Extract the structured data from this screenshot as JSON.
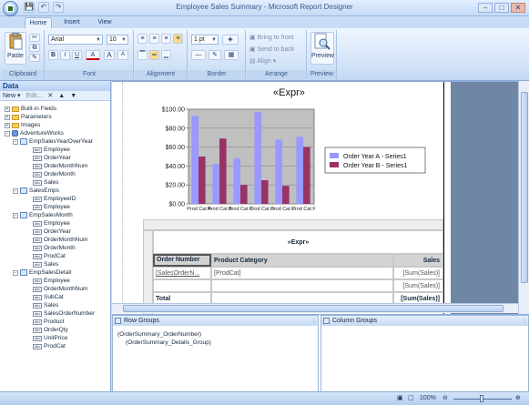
{
  "window": {
    "title": "Employee Sales Summary - Microsoft Report Designer"
  },
  "quick_access": {
    "save": "💾",
    "undo": "↶",
    "redo": "↷"
  },
  "tabs": [
    {
      "label": "Home"
    },
    {
      "label": "Insert"
    },
    {
      "label": "View"
    }
  ],
  "ribbon": {
    "clipboard": {
      "label": "Clipboard",
      "paste": "Paste"
    },
    "font": {
      "label": "Font",
      "family": "Arial",
      "size": "10",
      "bold": "B",
      "italic": "I",
      "underline": "U",
      "color": "A",
      "grow": "A",
      "shrink": "A"
    },
    "alignment": {
      "label": "Alignment"
    },
    "border": {
      "label": "Border",
      "width": "1 pt"
    },
    "arrange": {
      "label": "Arrange",
      "bring_to_front": "Bring to front",
      "send_to_back": "Send to back",
      "align": "Align"
    },
    "preview": {
      "label": "Preview",
      "button": "Preview"
    }
  },
  "data_pane": {
    "title": "Data",
    "new": "New",
    "edit": "Edit...",
    "top_items": [
      "Built-in Fields",
      "Parameters",
      "Images"
    ],
    "source": "AdventureWorks",
    "datasets": [
      {
        "name": "EmpSalesYearOverYear",
        "fields": [
          "Employee",
          "OrderYear",
          "OrderMonthNum",
          "OrderMonth",
          "Sales"
        ]
      },
      {
        "name": "SalesEmps",
        "fields": [
          "EmployeeID",
          "Employee"
        ]
      },
      {
        "name": "EmpSalesMonth",
        "fields": [
          "Employee",
          "OrderYear",
          "OrderMonthNum",
          "OrderMonth",
          "ProdCat",
          "Sales"
        ]
      },
      {
        "name": "EmpSalesDetail",
        "fields": [
          "Employee",
          "OrderMonthNum",
          "SubCat",
          "Sales",
          "SalesOrderNumber",
          "Product",
          "OrderQty",
          "UnitPrice",
          "ProdCat"
        ]
      }
    ]
  },
  "report": {
    "title_expr": "«Expr»",
    "tablix_title": "«Expr»",
    "headers": [
      "Order Number",
      "Product Category",
      "Sales"
    ],
    "detail": [
      "[SalesOrderN...",
      "[ProdCat]",
      "[Sum(Sales)]"
    ],
    "subtotal": "[Sum(Sales)]",
    "total_label": "Total",
    "total_value": "[Sum(Sales)]"
  },
  "chart_data": {
    "type": "bar",
    "categories": [
      "Prod Cat A",
      "Prod Cat B",
      "Prod Cat C",
      "Prod Cat D",
      "Prod Cat E",
      "Prod Cat F"
    ],
    "series": [
      {
        "name": "Order Year A - Series1",
        "color": "#9999ff",
        "values": [
          93,
          42,
          48,
          97,
          68,
          71
        ]
      },
      {
        "name": "Order Year B - Series1",
        "color": "#993366",
        "values": [
          50,
          69,
          20,
          25,
          19,
          60
        ]
      }
    ],
    "ylim": [
      0,
      100
    ],
    "yticks": [
      "$0.00",
      "$20.00",
      "$40.00",
      "$60.00",
      "$80.00",
      "$100.00"
    ],
    "plot_bg": "#c0c0c0",
    "legend_position": "right"
  },
  "row_groups": {
    "title": "Row Groups",
    "items": [
      "(OrderSummary_OrderNumber)",
      "(OrderSummary_Details_Group)"
    ]
  },
  "column_groups": {
    "title": "Column Groups"
  },
  "statusbar": {
    "zoom": "100%"
  }
}
